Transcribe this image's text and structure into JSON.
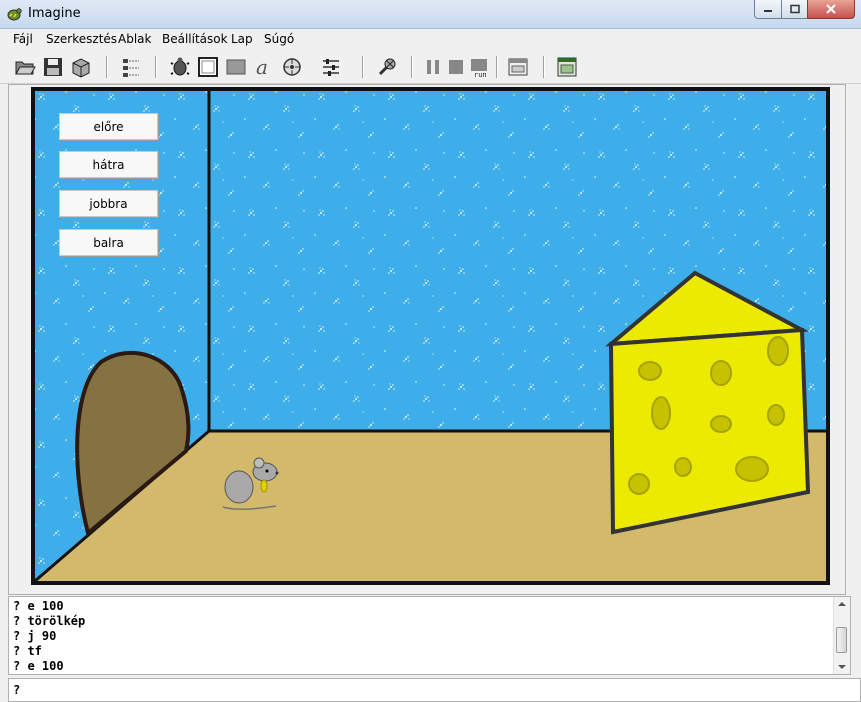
{
  "window": {
    "title": "Imagine"
  },
  "menu": {
    "items": [
      {
        "label": "Fájl"
      },
      {
        "label": "Szerkesztés"
      },
      {
        "label": "Ablak"
      },
      {
        "label": "Beállítások"
      },
      {
        "label": "Lap"
      },
      {
        "label": "Súgó"
      }
    ]
  },
  "toolbar": {
    "icons": [
      "open-folder-icon",
      "save-icon",
      "package-icon",
      "tree-view-icon",
      "turtle-icon",
      "frame-icon",
      "rectangle-icon",
      "text-tool-icon",
      "media-player-icon",
      "slider-control-icon",
      "run-cursor-icon",
      "pause-icon",
      "stop-icon",
      "run-icon",
      "window-icon",
      "pane-icon"
    ],
    "run_label": "run"
  },
  "scene": {
    "buttons": [
      {
        "label": "előre"
      },
      {
        "label": "hátra"
      },
      {
        "label": "jobbra"
      },
      {
        "label": "balra"
      }
    ],
    "colors": {
      "wall": "#3daee9",
      "floor": "#d2b96c",
      "cheese": "#ecea00",
      "hole": "#857243",
      "mouse": "#a9a9a9"
    }
  },
  "console": {
    "lines": [
      "? e 100",
      "? törölkép",
      "? j 90",
      "? tf",
      "? e 100"
    ]
  },
  "command_line": {
    "value": "?"
  }
}
